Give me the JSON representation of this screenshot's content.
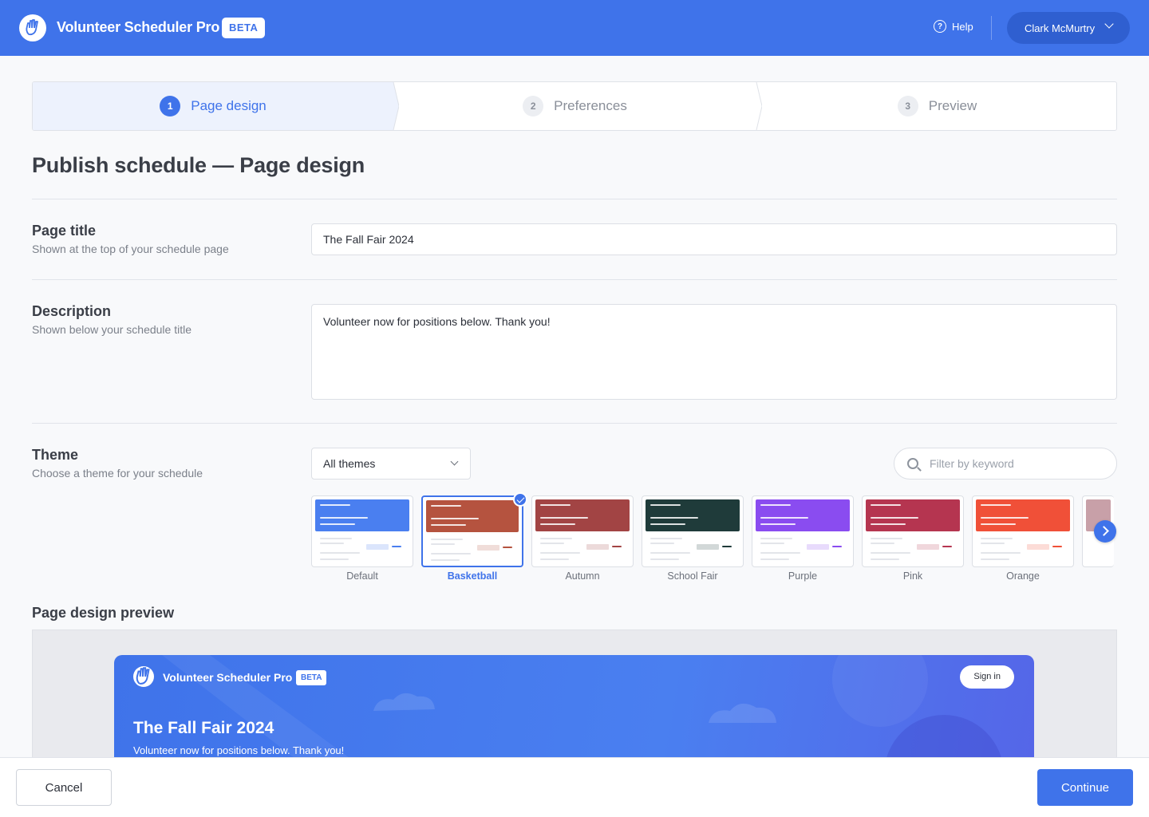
{
  "app": {
    "title": "Volunteer Scheduler Pro",
    "badge": "BETA"
  },
  "header": {
    "help_label": "Help",
    "user_name": "Clark McMurtry"
  },
  "stepper": [
    {
      "number": "1",
      "label": "Page design",
      "active": true
    },
    {
      "number": "2",
      "label": "Preferences",
      "active": false
    },
    {
      "number": "3",
      "label": "Preview",
      "active": false
    }
  ],
  "page_title": "Publish schedule — Page design",
  "fields": {
    "title": {
      "label": "Page title",
      "help": "Shown at the top of your schedule page",
      "value": "The Fall Fair 2024"
    },
    "description": {
      "label": "Description",
      "help": "Shown below your schedule title",
      "value": "Volunteer now for positions below. Thank you!"
    },
    "theme": {
      "label": "Theme",
      "help": "Choose a theme for your schedule",
      "filter_selected": "All themes",
      "search_placeholder": "Filter by keyword"
    }
  },
  "themes": [
    {
      "name": "Default",
      "color": "#4a7ff0",
      "selected": false
    },
    {
      "name": "Basketball",
      "color": "#b5533f",
      "selected": true
    },
    {
      "name": "Autumn",
      "color": "#a24444",
      "selected": false
    },
    {
      "name": "School Fair",
      "color": "#1f3b3a",
      "selected": false
    },
    {
      "name": "Purple",
      "color": "#8a4cf0",
      "selected": false
    },
    {
      "name": "Pink",
      "color": "#b53550",
      "selected": false
    },
    {
      "name": "Orange",
      "color": "#f05038",
      "selected": false
    }
  ],
  "preview": {
    "section_title": "Page design preview",
    "app_title": "Volunteer Scheduler Pro",
    "badge": "BETA",
    "sign_in": "Sign in",
    "title": "The Fall Fair 2024",
    "description": "Volunteer now for positions below. Thank you!"
  },
  "footer": {
    "cancel_label": "Cancel",
    "continue_label": "Continue"
  },
  "colors": {
    "primary": "#3f73ea",
    "primary_dark": "#2f5fd0",
    "step_active_bg": "#edf2fd"
  }
}
